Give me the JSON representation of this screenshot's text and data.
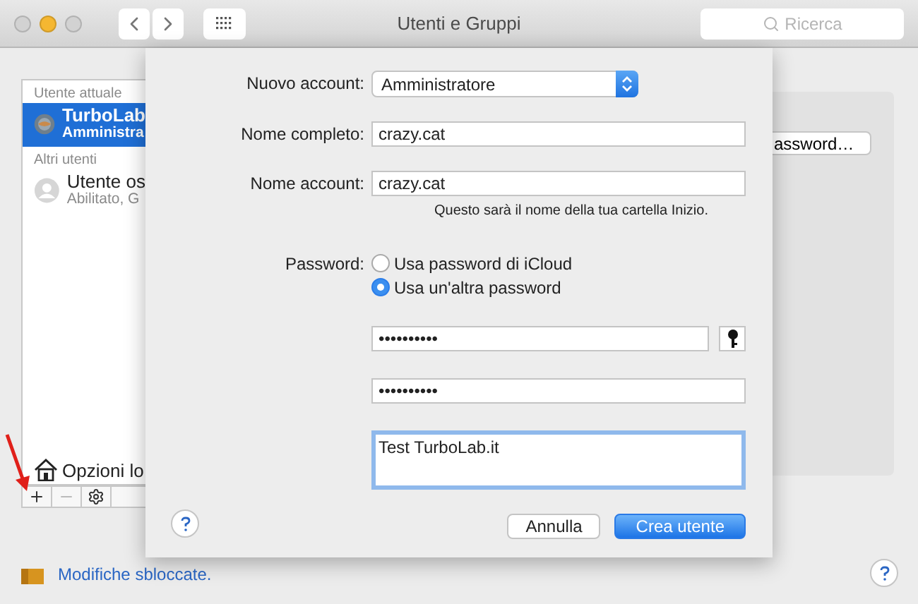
{
  "window": {
    "title": "Utenti e Gruppi",
    "search_placeholder": "Ricerca"
  },
  "sidebar": {
    "sections": [
      {
        "header": "Utente attuale",
        "users": [
          {
            "name": "TurboLab",
            "role": "Amministra",
            "selected": true,
            "kind": "admin"
          }
        ]
      },
      {
        "header": "Altri utenti",
        "users": [
          {
            "name": "Utente os",
            "role": "Abilitato, G",
            "selected": false,
            "kind": "guest"
          }
        ]
      }
    ],
    "login_options": "Opzioni lo"
  },
  "right_panel": {
    "button": "assword…"
  },
  "sheet": {
    "fields": [
      {
        "kind": "popup",
        "label": "Nuovo account:",
        "value": "Amministratore"
      },
      {
        "kind": "text",
        "label": "Nome completo:",
        "value": "crazy.cat"
      },
      {
        "kind": "text",
        "label": "Nome account:",
        "value": "crazy.cat",
        "hint": "Questo sarà il nome della tua cartella Inizio."
      },
      {
        "kind": "radio",
        "label": "Password:",
        "options": [
          {
            "label": "Usa password di iCloud",
            "selected": false
          },
          {
            "label": "Usa un'altra password",
            "selected": true
          }
        ]
      },
      {
        "kind": "password",
        "value": "••••••••••",
        "key_button": true
      },
      {
        "kind": "password",
        "value": "••••••••••",
        "key_button": false
      },
      {
        "kind": "textarea",
        "value": "Test TurboLab.it",
        "focused": true
      }
    ],
    "buttons": [
      {
        "label": "Annulla",
        "default": false
      },
      {
        "label": "Crea utente",
        "default": true
      }
    ]
  },
  "footer": {
    "lock_text": "Modifiche sbloccate."
  }
}
